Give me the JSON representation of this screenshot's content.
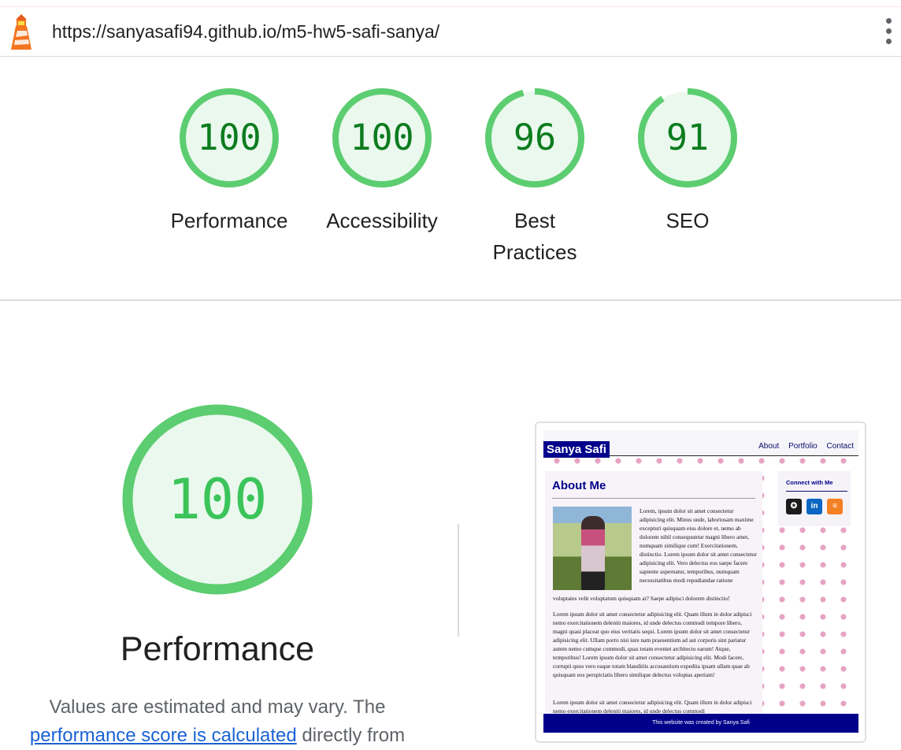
{
  "browser": {
    "url": "https://sanyasafi94.github.io/m5-hw5-safi-sanya/",
    "lighthouse_icon": "lighthouse-icon",
    "menu_icon": "more-vert-icon"
  },
  "scores": [
    {
      "label": "Performance",
      "score": "100",
      "value": 100
    },
    {
      "label": "Accessibility",
      "score": "100",
      "value": 100
    },
    {
      "label": "Best Practices",
      "score": "96",
      "value": 96
    },
    {
      "label": "SEO",
      "score": "91",
      "value": 91
    }
  ],
  "performance_section": {
    "score": "100",
    "value": 100,
    "title": "Performance",
    "desc_start": "Values are estimated and may vary. The ",
    "desc_link": "performance score is calculated",
    "desc_end": " directly from"
  },
  "screenshot": {
    "brand": "Sanya Safi",
    "nav_links": [
      "About",
      "Portfolio",
      "Contact"
    ],
    "about_heading": "About Me",
    "para1": "Lorem, ipsum dolor sit amet consectetur adipisicing elit. Minus unde, laboriosam maxime excepturi quisquam eius dolore et, nemo ab dolorem nihil consequuntur magni libero amet, numquam similique cum! Exercitationem, distinctio. Lorem ipsum dolor sit amet consectetur adipisicing elit. Vero delectus eos saepe facere sapiente aspernatur, temporibus, numquam necessitatibus modi repudiandae ratione",
    "para1_tail": "voluptates velit voluptatum quisquam at? Saepe adipisci dolorem distinctio!",
    "para2": "Lorem ipsum dolor sit amet consectetur adipisicing elit. Quam illum in dolor adipisci nemo exercitationem deleniti maiores, id unde delectus commodi tempore libero, magni quasi placeat quo eius veritatis sequi. Lorem ipsum dolor sit amet consectetur adipisicing elit. Ullam porro nisi iure nam praesentium ad aut corporis sint pariatur autem nemo cumque commodi, quas totam eveniet architecto earum! Atque, temporibus! Lorem ipsum dolor sit amet consectetur adipisicing elit. Modi facere, corrupti quos vero eaque totam blanditiis accusantium expedita ipsam ullam quae ab quisquam eos perspiciatis libero similique delectus voluptas aperiam!",
    "para3": "Lorem ipsum dolor sit amet consectetur adipisicing elit. Quam illum in dolor adipisci nemo exercitationem deleniti maiores, id unde delectus commodi",
    "connect_title": "Connect with Me",
    "social": [
      {
        "icon": "github-icon",
        "glyph": "✪"
      },
      {
        "icon": "linkedin-icon",
        "glyph": "in"
      },
      {
        "icon": "stackoverflow-icon",
        "glyph": "≡"
      }
    ],
    "footer": "This website was created by Sanya Safi"
  },
  "colors": {
    "pass_green": "#0c7c1e",
    "gauge_ring": "#5ccd70",
    "gauge_fill": "#eaf8ee",
    "big_score": "#3bc45a",
    "link": "#1a62d6"
  }
}
